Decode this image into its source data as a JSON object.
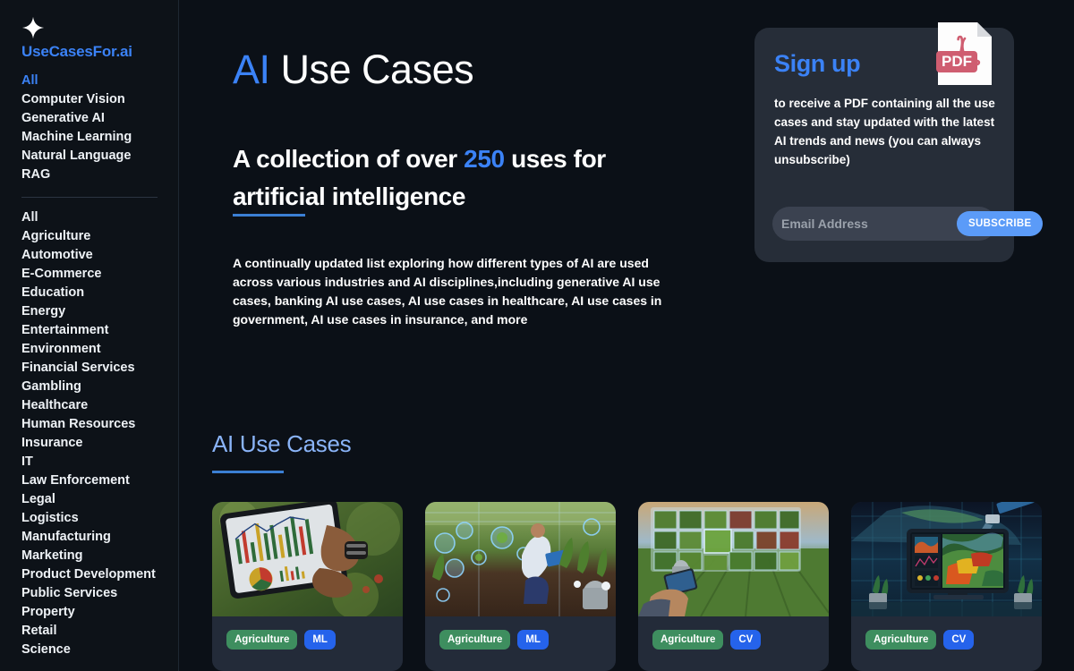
{
  "sidebar": {
    "logo_icon": "sparkle-icon",
    "brand": "UseCasesFor.ai",
    "primary_nav": [
      {
        "label": "All",
        "active": true
      },
      {
        "label": "Computer Vision",
        "active": false
      },
      {
        "label": "Generative AI",
        "active": false
      },
      {
        "label": "Machine Learning",
        "active": false
      },
      {
        "label": "Natural Language",
        "active": false
      },
      {
        "label": "RAG",
        "active": false
      }
    ],
    "secondary_nav": [
      {
        "label": "All"
      },
      {
        "label": "Agriculture"
      },
      {
        "label": "Automotive"
      },
      {
        "label": "E-Commerce"
      },
      {
        "label": "Education"
      },
      {
        "label": "Energy"
      },
      {
        "label": "Entertainment"
      },
      {
        "label": "Environment"
      },
      {
        "label": "Financial Services"
      },
      {
        "label": "Gambling"
      },
      {
        "label": "Healthcare"
      },
      {
        "label": "Human Resources"
      },
      {
        "label": "Insurance"
      },
      {
        "label": "IT"
      },
      {
        "label": "Law Enforcement"
      },
      {
        "label": "Legal"
      },
      {
        "label": "Logistics"
      },
      {
        "label": "Manufacturing"
      },
      {
        "label": "Marketing"
      },
      {
        "label": "Product Development"
      },
      {
        "label": "Public Services"
      },
      {
        "label": "Property"
      },
      {
        "label": "Retail"
      },
      {
        "label": "Science"
      }
    ]
  },
  "hero": {
    "title_accent": "AI",
    "title_rest": " Use Cases",
    "subhead_before": "A collection of over ",
    "subhead_count": "250",
    "subhead_after": " uses for artificial intelligence",
    "lede": "A continually updated list exploring how different types of AI are used across various industries and AI disciplines,including generative AI use cases, banking AI use cases, AI use cases in healthcare, AI use cases in government, AI use cases in insurance, and more"
  },
  "signup": {
    "title": "Sign up",
    "body": "to receive a PDF containing all the use cases and stay updated with the latest AI trends and news (you can always unsubscribe)",
    "email_value": "",
    "email_placeholder": "Email Address",
    "subscribe_label": "SUBSCRIBE",
    "pdf_icon": "pdf-file-icon",
    "pdf_badge": "PDF"
  },
  "section": {
    "title": "AI Use Cases"
  },
  "cards": [
    {
      "image_alt": "hands holding tablet showing charts in a field",
      "category": "Agriculture",
      "discipline": "ML"
    },
    {
      "image_alt": "researcher crouching in crop field with tablet and data overlays",
      "category": "Agriculture",
      "discipline": "ML"
    },
    {
      "image_alt": "farmer with tablet and grid of plant images overlay above crop rows",
      "category": "Agriculture",
      "discipline": "CV"
    },
    {
      "image_alt": "satellite imagery heatmap of farmland on a monitor",
      "category": "Agriculture",
      "discipline": "CV"
    }
  ],
  "colors": {
    "page_bg": "#0b1017",
    "sidebar_bg": "#0d1218",
    "accent_blue": "#3b82f6",
    "section_blue": "#8ab4f8",
    "card_bg": "#232b39",
    "signup_bg": "#262d38",
    "tag_category": "#3e8e5f",
    "tag_discipline": "#2563eb",
    "subscribe_bg": "#5b9bf8",
    "pdf_red": "#cf5d70"
  }
}
